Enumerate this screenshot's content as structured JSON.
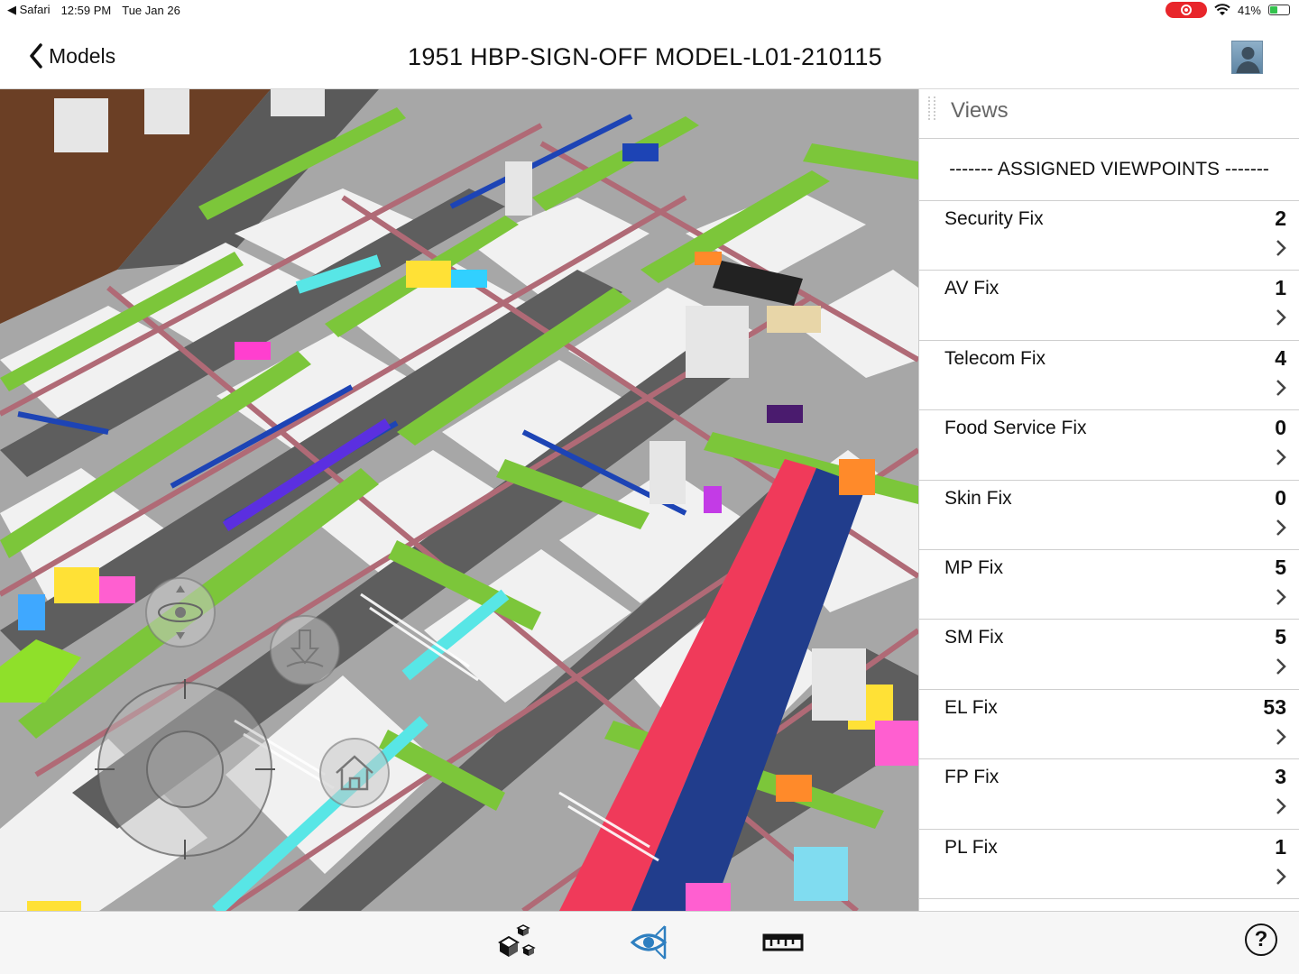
{
  "status_bar": {
    "app": "Safari",
    "time": "12:59 PM",
    "date": "Tue Jan 26",
    "battery": "41%",
    "battery_level": 0.41
  },
  "header": {
    "back_label": "Models",
    "title": "1951 HBP-SIGN-OFF MODEL-L01-210115"
  },
  "panel": {
    "title": "Views",
    "section": "------- ASSIGNED VIEWPOINTS -------",
    "items": [
      {
        "label": "Security Fix",
        "count": "2"
      },
      {
        "label": "AV Fix",
        "count": "1"
      },
      {
        "label": "Telecom Fix",
        "count": "4"
      },
      {
        "label": "Food Service Fix",
        "count": "0"
      },
      {
        "label": "Skin Fix",
        "count": "0"
      },
      {
        "label": "MP Fix",
        "count": "5"
      },
      {
        "label": "SM Fix",
        "count": "5"
      },
      {
        "label": "EL Fix",
        "count": "53"
      },
      {
        "label": "FP Fix",
        "count": "3"
      },
      {
        "label": "PL Fix",
        "count": "1"
      },
      {
        "label": "",
        "count": ""
      }
    ]
  },
  "toolbar": {
    "help_label": "?"
  },
  "icons": {
    "back": "chevron-left-icon",
    "objects": "cubes-icon",
    "views": "eye-icon",
    "measure": "ruler-icon",
    "help": "help-icon"
  },
  "colors": {
    "accent": "#2e7fc0",
    "beam_green": "#7cc63a",
    "record": "#e8262b"
  }
}
